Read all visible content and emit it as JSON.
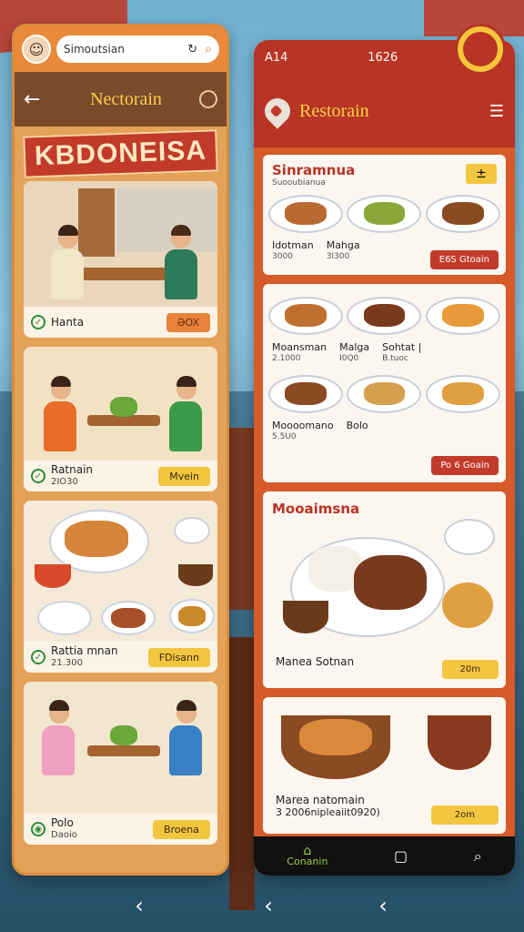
{
  "left_phone": {
    "search": {
      "value": "Simoutsian"
    },
    "header": {
      "back_icon": "back-arrow-icon",
      "title": "Nectorain"
    },
    "banner": "KBDONEISA",
    "cards": [
      {
        "name": "Hanta",
        "price": "",
        "button": "ƏOX",
        "button_style": "orange"
      },
      {
        "name": "Ratnain",
        "price": "2IO30",
        "button": "Mvein",
        "button_style": "yellow"
      },
      {
        "name": "Rattia mnan",
        "price": "21.300",
        "button": "FDisann",
        "button_style": "yellow"
      },
      {
        "name": "Polo",
        "price": "Daoio",
        "button": "Broena",
        "button_style": "yellow"
      }
    ]
  },
  "right_phone": {
    "status": {
      "signal": "A14",
      "time": "1626"
    },
    "header": {
      "title": "Restorain"
    },
    "section1": {
      "title": "Sinramnua",
      "subtitle": "Suooubianua",
      "items": [
        {
          "name": "Idotman",
          "price": "3000"
        },
        {
          "name": "Mahga",
          "price": "3I300"
        }
      ],
      "tag": "±",
      "button": "E6S Gtoain"
    },
    "section2": {
      "items_row1": [
        {
          "name": "Moansman",
          "price": "2.1000"
        },
        {
          "name": "Malga",
          "price": "I0Q0"
        },
        {
          "name": "Sohtat |",
          "price": "B.tuoc"
        }
      ],
      "items_row2": [
        {
          "name": "Moooomano",
          "price": "5.5U0"
        },
        {
          "name": "Bolo",
          "price": ""
        }
      ],
      "button": "Po 6 Goain"
    },
    "section3": {
      "title": "Mooaimsna",
      "dish_name": "Manea Sotnan",
      "button": "20m"
    },
    "section4": {
      "dish_name": "Marea natomain",
      "price": "3 2006nipleaiit0920)",
      "button": "2om"
    },
    "nav": {
      "home_label": "Conanin"
    }
  },
  "colors": {
    "brand_red": "#b83424",
    "accent_yellow": "#f3c640",
    "accent_orange": "#e9813a"
  }
}
